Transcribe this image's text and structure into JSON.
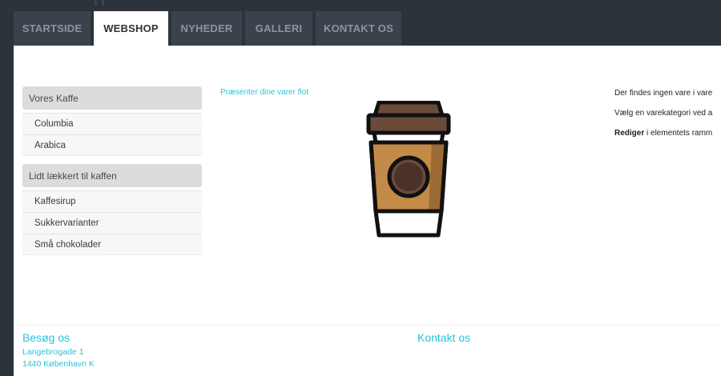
{
  "nav": {
    "tabs": [
      {
        "label": "STARTSIDE"
      },
      {
        "label": "WEBSHOP"
      },
      {
        "label": "NYHEDER"
      },
      {
        "label": "GALLERI"
      },
      {
        "label": "KONTAKT OS"
      }
    ],
    "active_tab": "WEBSHOP"
  },
  "sidebar": {
    "categories": [
      {
        "title": "Vores Kaffe",
        "items": [
          "Columbia",
          "Arabica"
        ]
      },
      {
        "title": "Lidt lækkert til kaffen",
        "items": [
          "Kaffesirup",
          "Sukkervarianter",
          "Små chokolader"
        ]
      }
    ]
  },
  "main": {
    "tagline": "Præsenter dine varer flot",
    "image_icon": "coffee-cup-icon"
  },
  "notice": {
    "line1": "Der findes ingen vare i vare",
    "line2": "Vælg en varekategori ved a",
    "line3_bold": "Rediger",
    "line3_rest": " i elementets ramm"
  },
  "footer": {
    "visit_title": "Besøg os",
    "address_line1": "Langebrogade 1",
    "address_line2": "1440 København K",
    "contact_title": "Kontakt os"
  },
  "colors": {
    "accent": "#29c4d6",
    "dark": "#2c333b",
    "tab": "#3a424b"
  }
}
